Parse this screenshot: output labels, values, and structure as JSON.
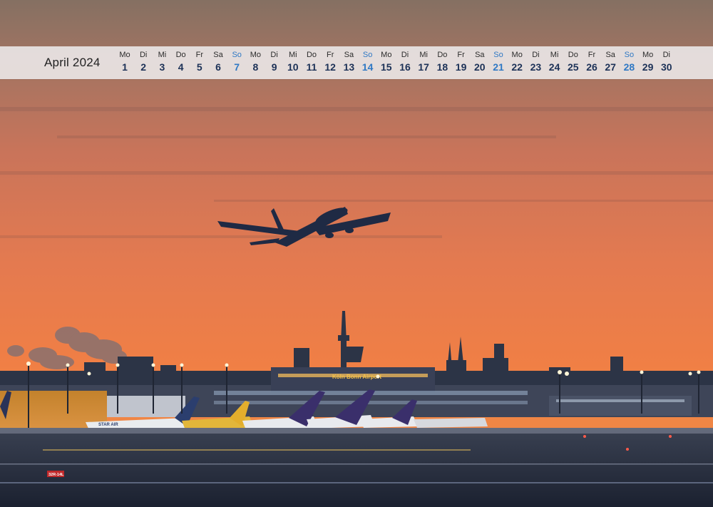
{
  "calendar": {
    "month_title": "April 2024",
    "days": [
      {
        "weekday": "Mo",
        "day": "1",
        "sunday": false
      },
      {
        "weekday": "Di",
        "day": "2",
        "sunday": false
      },
      {
        "weekday": "Mi",
        "day": "3",
        "sunday": false
      },
      {
        "weekday": "Do",
        "day": "4",
        "sunday": false
      },
      {
        "weekday": "Fr",
        "day": "5",
        "sunday": false
      },
      {
        "weekday": "Sa",
        "day": "6",
        "sunday": false
      },
      {
        "weekday": "So",
        "day": "7",
        "sunday": true
      },
      {
        "weekday": "Mo",
        "day": "8",
        "sunday": false
      },
      {
        "weekday": "Di",
        "day": "9",
        "sunday": false
      },
      {
        "weekday": "Mi",
        "day": "10",
        "sunday": false
      },
      {
        "weekday": "Do",
        "day": "11",
        "sunday": false
      },
      {
        "weekday": "Fr",
        "day": "12",
        "sunday": false
      },
      {
        "weekday": "Sa",
        "day": "13",
        "sunday": false
      },
      {
        "weekday": "So",
        "day": "14",
        "sunday": true
      },
      {
        "weekday": "Mo",
        "day": "15",
        "sunday": false
      },
      {
        "weekday": "Di",
        "day": "16",
        "sunday": false
      },
      {
        "weekday": "Mi",
        "day": "17",
        "sunday": false
      },
      {
        "weekday": "Do",
        "day": "18",
        "sunday": false
      },
      {
        "weekday": "Fr",
        "day": "19",
        "sunday": false
      },
      {
        "weekday": "Sa",
        "day": "20",
        "sunday": false
      },
      {
        "weekday": "So",
        "day": "21",
        "sunday": true
      },
      {
        "weekday": "Mo",
        "day": "22",
        "sunday": false
      },
      {
        "weekday": "Di",
        "day": "23",
        "sunday": false
      },
      {
        "weekday": "Mi",
        "day": "24",
        "sunday": false
      },
      {
        "weekday": "Do",
        "day": "25",
        "sunday": false
      },
      {
        "weekday": "Fr",
        "day": "26",
        "sunday": false
      },
      {
        "weekday": "Sa",
        "day": "27",
        "sunday": false
      },
      {
        "weekday": "So",
        "day": "28",
        "sunday": true
      },
      {
        "weekday": "Mo",
        "day": "29",
        "sunday": false
      },
      {
        "weekday": "Di",
        "day": "30",
        "sunday": false
      }
    ]
  },
  "photo": {
    "terminal_sign": "Köln Bonn Airport",
    "aircraft_livery": "STAR AIR",
    "runway_sign": "32R-14L"
  },
  "colors": {
    "sky_top": "#8a7366",
    "sky_orange": "#ee7a47",
    "sunday_accent": "#2f78c4",
    "date_navy": "#1c3157"
  }
}
